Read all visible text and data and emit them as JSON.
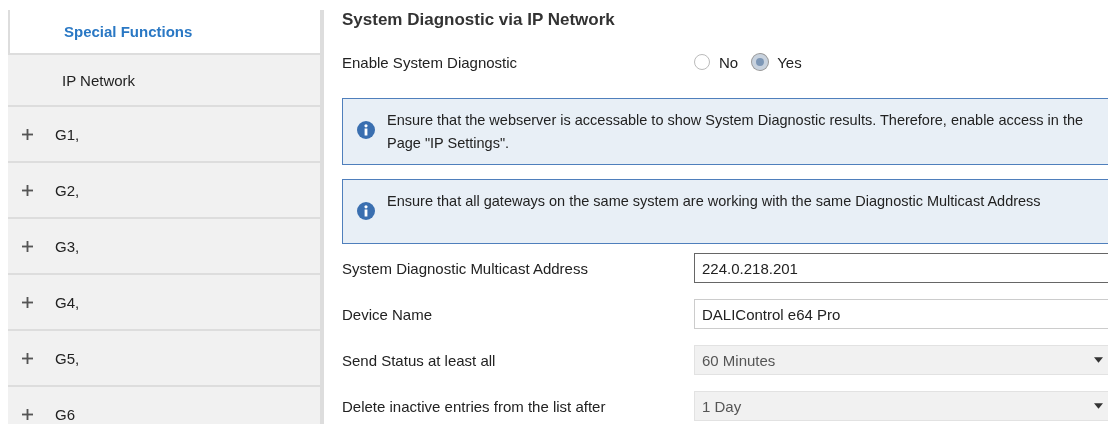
{
  "sidebar": {
    "items": [
      {
        "label": "Special Functions",
        "kind": "header",
        "selected": true
      },
      {
        "label": "IP Network",
        "kind": "page",
        "selected": false
      },
      {
        "label": "G1,",
        "kind": "group",
        "selected": false,
        "expanded": false
      },
      {
        "label": "G2,",
        "kind": "group",
        "selected": false,
        "expanded": false
      },
      {
        "label": "G3,",
        "kind": "group",
        "selected": false,
        "expanded": false
      },
      {
        "label": "G4,",
        "kind": "group",
        "selected": false,
        "expanded": false
      },
      {
        "label": "G5,",
        "kind": "group",
        "selected": false,
        "expanded": false
      },
      {
        "label": "G6",
        "kind": "group",
        "selected": false,
        "expanded": false
      }
    ]
  },
  "main": {
    "title": "System Diagnostic via IP Network",
    "enable": {
      "label": "Enable System Diagnostic",
      "options": [
        {
          "label": "No",
          "selected": false
        },
        {
          "label": "Yes",
          "selected": true
        }
      ]
    },
    "notes": [
      {
        "text": "Ensure that the webserver is accessable to show System Diagnostic results. Therefore, enable access in the Page \"IP Settings\"."
      },
      {
        "text": "Ensure that all gateways on the same system are working with the same Diagnostic Multicast Address"
      }
    ],
    "fields": [
      {
        "label": "System Diagnostic Multicast Address",
        "kind": "text",
        "value": "224.0.218.201",
        "focused": true,
        "disabled": false
      },
      {
        "label": "Device Name",
        "kind": "text",
        "value": "DALIControl e64 Pro",
        "focused": false,
        "disabled": false
      },
      {
        "label": "Send Status at least all",
        "kind": "dropdown",
        "value": "60 Minutes",
        "focused": false,
        "disabled": true
      },
      {
        "label": "Delete inactive entries from the list after",
        "kind": "dropdown",
        "value": "1 Day",
        "focused": false,
        "disabled": true
      }
    ]
  }
}
